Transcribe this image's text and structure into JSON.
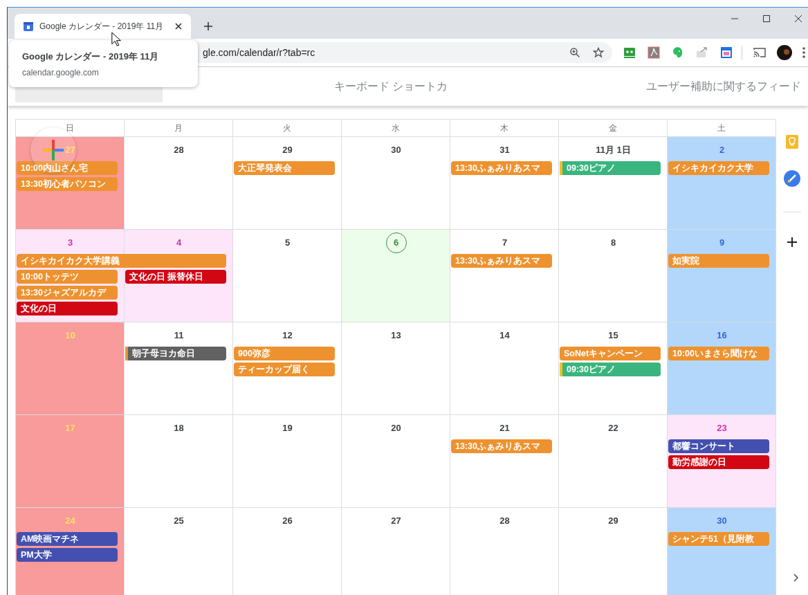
{
  "browser": {
    "tab": {
      "title": "Google カレンダー - 2019年 11月",
      "selected": true
    },
    "address": "gle.com/calendar/r?tab=rc",
    "tooltip": {
      "title": "Google カレンダー - 2019年 11月",
      "url": "calendar.google.com"
    }
  },
  "header": {
    "links": [
      "キーボード ショートカ",
      "ユーザー補助に関するフィード"
    ]
  },
  "calendar": {
    "weekdays": [
      "日",
      "月",
      "火",
      "水",
      "木",
      "金",
      "土"
    ],
    "weeks": [
      {
        "days": [
          {
            "label": "27",
            "kind": "sunday",
            "events": [
              {
                "text": "10:00内山さん宅",
                "color": "#ee922f"
              },
              {
                "text": "13:30初心者パソコン",
                "color": "#ee922f"
              }
            ]
          },
          {
            "label": "28",
            "kind": "normal"
          },
          {
            "label": "29",
            "kind": "normal",
            "events": [
              {
                "text": "大正琴発表会",
                "color": "#ee922f"
              }
            ]
          },
          {
            "label": "30",
            "kind": "normal"
          },
          {
            "label": "31",
            "kind": "normal",
            "events": [
              {
                "text": "13:30ふぁみりあスマ",
                "color": "#ee922f"
              }
            ]
          },
          {
            "label": "11月 1日",
            "kind": "normal",
            "events": [
              {
                "text": "09:30ピアノ",
                "color": "#3bb57f",
                "accent": {
                  "color": "#f6bf26"
                }
              }
            ]
          },
          {
            "label": "2",
            "kind": "saturday",
            "events": [
              {
                "text": "イシキカイカク大学",
                "color": "#ee922f"
              }
            ]
          }
        ]
      },
      {
        "days": [
          {
            "label": "3",
            "kind": "holiday",
            "events": [
              {
                "text": "イシキカイカク大学講義",
                "color": "#ee922f",
                "multi_day": true
              },
              {
                "text": "10:00トッテツ",
                "color": "#ee922f"
              },
              {
                "text": "13:30ジャズアルカデ",
                "color": "#ee922f"
              },
              {
                "text": "文化の日",
                "color": "#d20714"
              }
            ]
          },
          {
            "label": "4",
            "kind": "holiday",
            "events": [
              {
                "text": "文化の日 振替休日",
                "color": "#d20714"
              }
            ]
          },
          {
            "label": "5",
            "kind": "normal"
          },
          {
            "label": "6",
            "kind": "today"
          },
          {
            "label": "7",
            "kind": "normal",
            "events": [
              {
                "text": "13:30ふぁみりあスマ",
                "color": "#ee922f"
              }
            ]
          },
          {
            "label": "8",
            "kind": "normal"
          },
          {
            "label": "9",
            "kind": "saturday",
            "events": [
              {
                "text": "如実院",
                "color": "#ee922f"
              }
            ]
          }
        ]
      },
      {
        "days": [
          {
            "label": "10",
            "kind": "sunday"
          },
          {
            "label": "11",
            "kind": "normal",
            "events": [
              {
                "text": "朝子母ヨカ命日",
                "color": "#616161",
                "accent": {
                  "color": "#ee922f"
                }
              }
            ]
          },
          {
            "label": "12",
            "kind": "normal",
            "events": [
              {
                "text": "900弥彦",
                "color": "#ee922f"
              },
              {
                "text": "ティーカップ届く",
                "color": "#ee922f"
              }
            ]
          },
          {
            "label": "13",
            "kind": "normal"
          },
          {
            "label": "14",
            "kind": "normal"
          },
          {
            "label": "15",
            "kind": "normal",
            "events": [
              {
                "text": "SoNetキャンペーン",
                "color": "#ee922f"
              },
              {
                "text": "09:30ピアノ",
                "color": "#3bb57f",
                "accent": {
                  "color": "#f6bf26"
                }
              }
            ]
          },
          {
            "label": "16",
            "kind": "saturday",
            "events": [
              {
                "text": "10:00いまさら聞けな",
                "color": "#ee922f"
              }
            ]
          }
        ]
      },
      {
        "days": [
          {
            "label": "17",
            "kind": "sunday"
          },
          {
            "label": "18",
            "kind": "normal"
          },
          {
            "label": "19",
            "kind": "normal"
          },
          {
            "label": "20",
            "kind": "normal"
          },
          {
            "label": "21",
            "kind": "normal",
            "events": [
              {
                "text": "13:30ふぁみりあスマ",
                "color": "#ee922f"
              }
            ]
          },
          {
            "label": "22",
            "kind": "normal"
          },
          {
            "label": "23",
            "kind": "holiday",
            "events": [
              {
                "text": "都響コンサート",
                "color": "#4450b0"
              },
              {
                "text": "勤労感謝の日",
                "color": "#d20714"
              }
            ]
          }
        ]
      },
      {
        "days": [
          {
            "label": "24",
            "kind": "sunday",
            "events": [
              {
                "text": "AM映画マチネ",
                "color": "#4450b0"
              },
              {
                "text": "PM大学",
                "color": "#4450b0"
              }
            ]
          },
          {
            "label": "25",
            "kind": "normal"
          },
          {
            "label": "26",
            "kind": "normal"
          },
          {
            "label": "27",
            "kind": "normal"
          },
          {
            "label": "28",
            "kind": "normal"
          },
          {
            "label": "29",
            "kind": "normal"
          },
          {
            "label": "30",
            "kind": "saturday",
            "events": [
              {
                "text": "シャンテ51（見附教",
                "color": "#ee922f"
              }
            ]
          }
        ]
      }
    ]
  }
}
